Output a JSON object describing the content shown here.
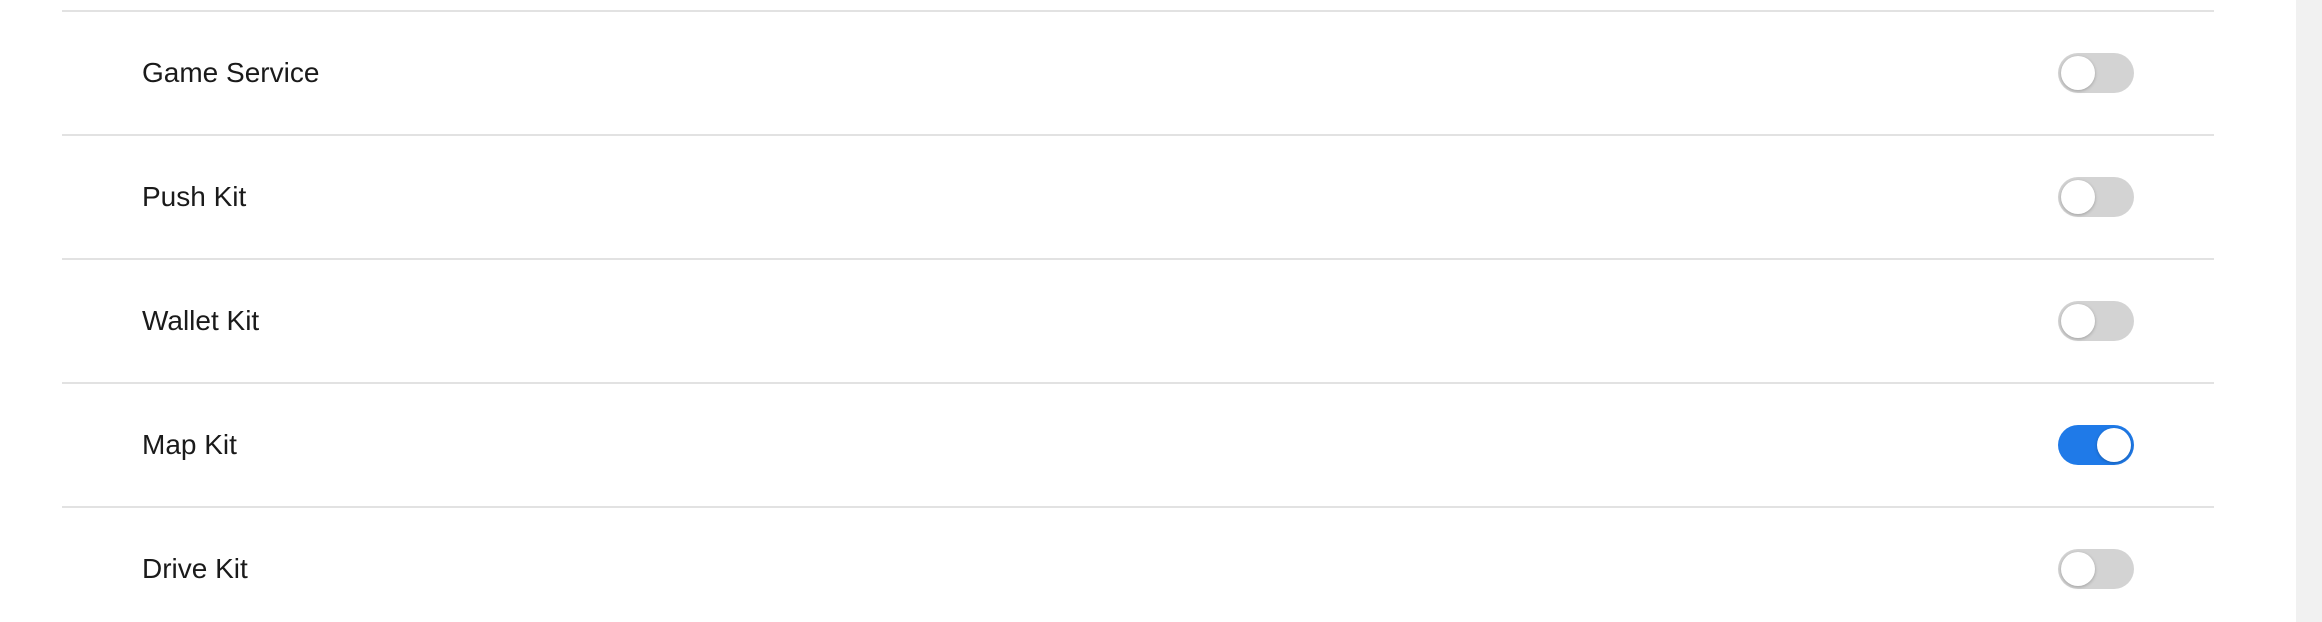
{
  "settings": {
    "items": [
      {
        "label": "Game Service",
        "enabled": false
      },
      {
        "label": "Push Kit",
        "enabled": false
      },
      {
        "label": "Wallet Kit",
        "enabled": false
      },
      {
        "label": "Map Kit",
        "enabled": true
      },
      {
        "label": "Drive Kit",
        "enabled": false
      }
    ]
  },
  "colors": {
    "toggle_on": "#1f7ae8",
    "toggle_off": "#d3d3d3"
  }
}
